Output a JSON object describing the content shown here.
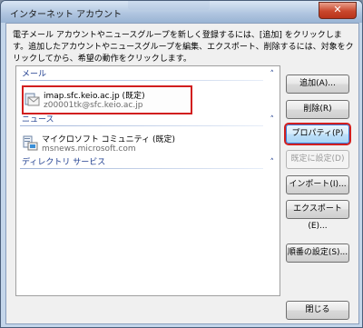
{
  "window": {
    "title": "インターネット アカウント",
    "close_glyph": "✕"
  },
  "description": "電子メール アカウントやニュースグループを新しく登録するには、[追加] をクリックします。追加したアカウントやニュースグループを編集、エクスポート、削除するには、対象をクリックしてから、希望の動作をクリックします。",
  "groups": [
    {
      "label": "メール",
      "accounts": [
        {
          "name": "imap.sfc.keio.ac.jp (既定)",
          "address": "z00001tk@sfc.keio.ac.jp",
          "icon": "mail-account-icon",
          "selected": true
        }
      ]
    },
    {
      "label": "ニュース",
      "accounts": [
        {
          "name": "マイクロソフト コミュニティ (既定)",
          "address": "msnews.microsoft.com",
          "icon": "news-account-icon",
          "selected": false
        }
      ]
    },
    {
      "label": "ディレクトリ サービス",
      "accounts": []
    }
  ],
  "group_chevron": "˄",
  "buttons": {
    "add": "追加(A)...",
    "remove": "削除(R)",
    "properties": "プロパティ(P)",
    "set_default": "既定に設定(D)",
    "import": "インポート(I)...",
    "export": "エクスポート(E)...",
    "order": "順番の設定(S)...",
    "close": "閉じる"
  },
  "colors": {
    "group_header": "#1e3d8f",
    "highlight": "#d21f1f"
  }
}
